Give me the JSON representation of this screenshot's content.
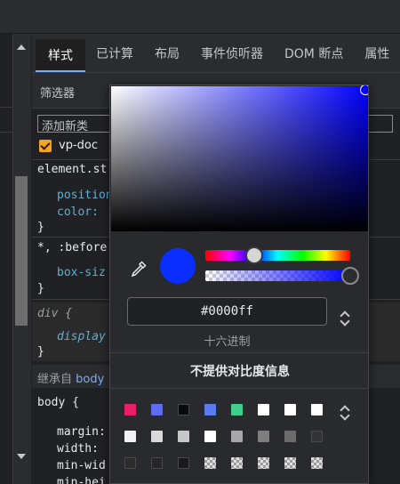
{
  "tabs": [
    {
      "label": "样式",
      "active": true
    },
    {
      "label": "已计算"
    },
    {
      "label": "布局"
    },
    {
      "label": "事件侦听器"
    },
    {
      "label": "DOM 断点"
    },
    {
      "label": "属性"
    }
  ],
  "filter": {
    "label": "筛选器"
  },
  "add_class": {
    "placeholder": "添加新类"
  },
  "class_checkbox": {
    "label": "vp-doc",
    "checked": true
  },
  "rules": {
    "element_style": {
      "selector": "element.st",
      "props": [
        "position",
        "color: "
      ],
      "close": "}"
    },
    "universal": {
      "selector": "*, :before",
      "props": [
        "box-siz"
      ],
      "close": "}"
    },
    "div": {
      "selector": "div {",
      "props": [
        "display"
      ],
      "close": "}"
    },
    "body": {
      "selector": "body {",
      "props": [
        "margin:",
        "width:",
        "min-wid",
        "min-hei"
      ]
    }
  },
  "inherited": {
    "prefix": "继承自 ",
    "link": "body"
  },
  "picker": {
    "current_color": "#0000ff",
    "hex_value": "#0000ff",
    "format_label": "十六进制",
    "contrast_text": "不提供对比度信息",
    "palette": [
      [
        "#e91e63",
        "#5c6bf0",
        "#0a0a0a",
        "#5a7cf0",
        "#3ecf8e",
        "#ffffff",
        "#ffffff",
        "#ffffff"
      ],
      [
        "#f2f2f2",
        "#d9d9d9",
        "#c8c8c8",
        "#ffffff",
        "#a8a8a8",
        "#7e7e7e",
        "#6c6c6c",
        "#333333"
      ],
      [
        "#2b2b2b",
        "#262626",
        "#1a1a1a",
        "checker",
        "checker",
        "checker",
        "checker",
        "checker"
      ]
    ]
  }
}
